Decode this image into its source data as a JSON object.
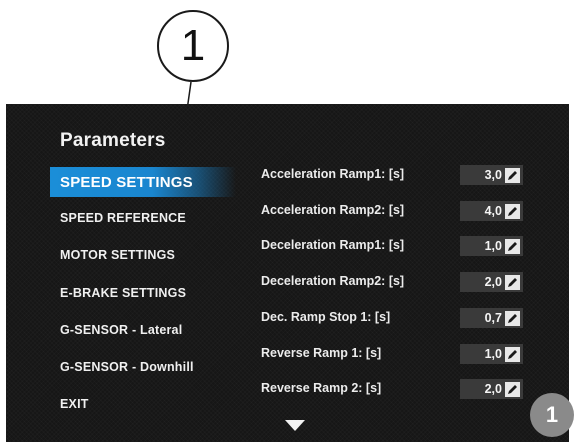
{
  "callout": {
    "number": "1"
  },
  "screen": {
    "title": "Parameters",
    "menu": [
      {
        "label": "SPEED SETTINGS",
        "active": true
      },
      {
        "label": "SPEED REFERENCE",
        "active": false
      },
      {
        "label": "MOTOR SETTINGS",
        "active": false
      },
      {
        "label": "E-BRAKE SETTINGS",
        "active": false
      },
      {
        "label": "G-SENSOR - Lateral",
        "active": false
      },
      {
        "label": "G-SENSOR - Downhill",
        "active": false
      },
      {
        "label": "EXIT",
        "active": false
      }
    ],
    "params": [
      {
        "label": "Acceleration Ramp1: [s]",
        "value": "3,0"
      },
      {
        "label": "Acceleration Ramp2: [s]",
        "value": "4,0"
      },
      {
        "label": "Deceleration Ramp1: [s]",
        "value": "1,0"
      },
      {
        "label": "Deceleration Ramp2: [s]",
        "value": "2,0"
      },
      {
        "label": "Dec. Ramp Stop 1: [s]",
        "value": "0,7"
      },
      {
        "label": "Reverse Ramp 1: [s]",
        "value": "1,0"
      },
      {
        "label": "Reverse Ramp 2: [s]",
        "value": "2,0"
      }
    ],
    "icons": {
      "edit": "pencil-icon",
      "scroll": "triangle-down-icon"
    }
  },
  "page_badge": "1"
}
